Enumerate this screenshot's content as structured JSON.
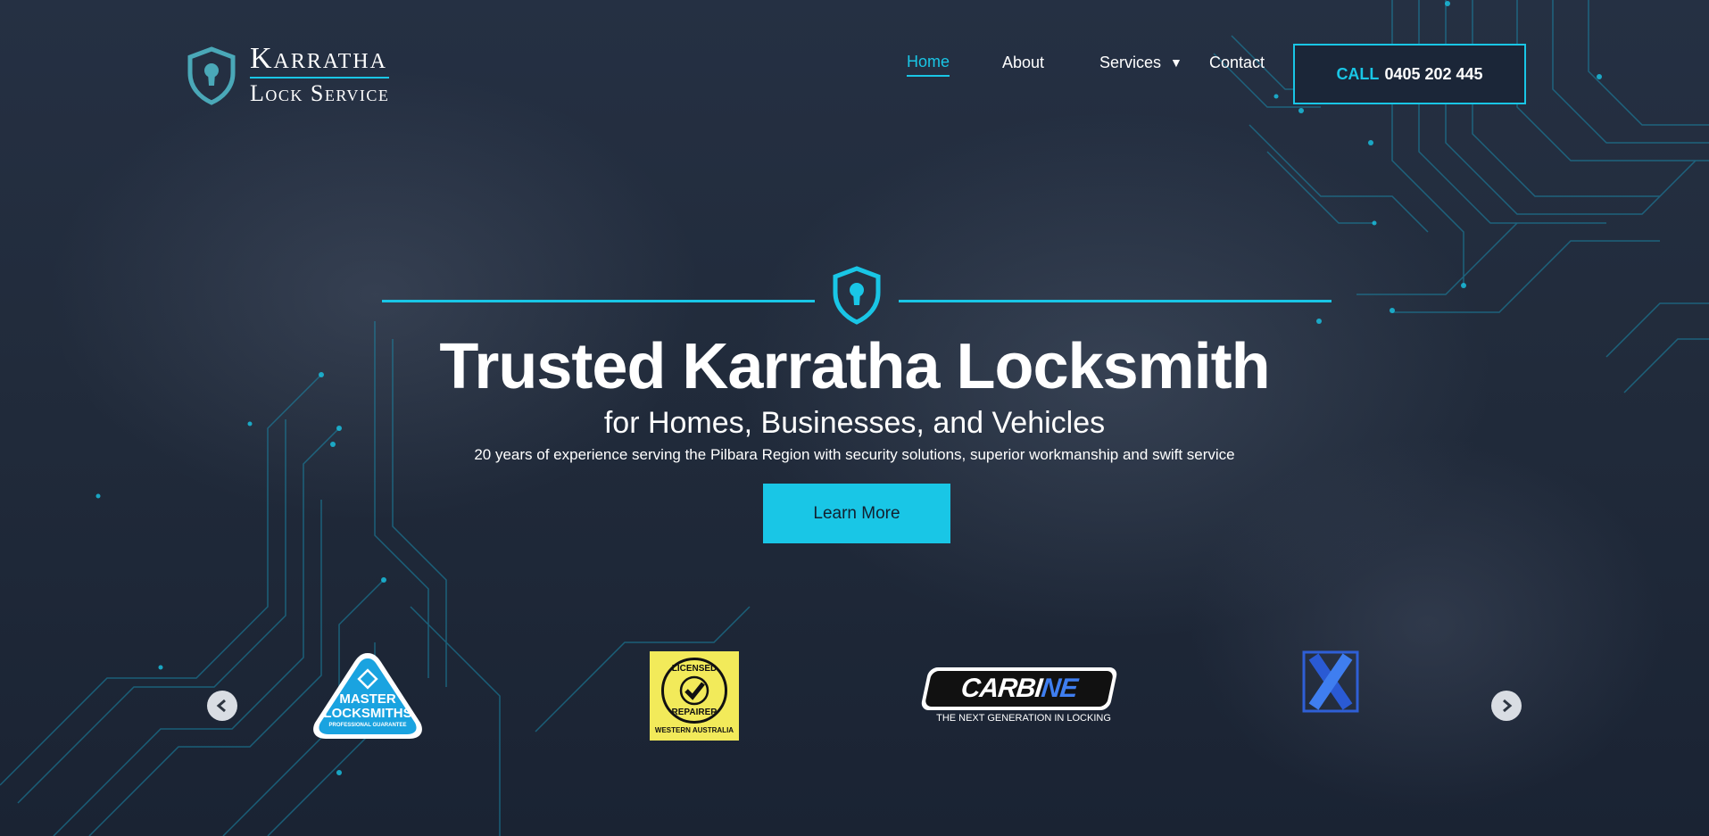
{
  "header": {
    "logo": {
      "line1": "Karratha",
      "line2": "Lock Service"
    },
    "nav": [
      {
        "label": "Home",
        "active": true
      },
      {
        "label": "About",
        "active": false
      },
      {
        "label": "Services",
        "active": false,
        "has_dropdown": true
      },
      {
        "label": "Contact",
        "active": false
      }
    ],
    "call_button": {
      "prefix": "CALL",
      "number": "0405 202 445"
    }
  },
  "hero": {
    "title": "Trusted Karratha Locksmith",
    "subtitle": "for Homes, Businesses, and Vehicles",
    "tagline": "20 years of experience serving the Pilbara Region with security solutions, superior workmanship and swift service",
    "cta_label": "Learn More"
  },
  "carousel": {
    "prev_icon": "chevron-left-icon",
    "next_icon": "chevron-right-icon",
    "brands": [
      {
        "name": "master-locksmiths",
        "line1": "MASTER",
        "line2": "LOCKSMITHS",
        "line3": "PROFESSIONAL GUARANTEE"
      },
      {
        "name": "licensed-repairer",
        "line1": "LICENSED",
        "line2": "REPAIRER",
        "line3": "WESTERN AUSTRALIA"
      },
      {
        "name": "carbine",
        "word_a": "CARBI",
        "word_b": "NE",
        "tagline": "THE NEXT GENERATION IN LOCKING"
      },
      {
        "name": "x-brand"
      }
    ]
  },
  "colors": {
    "accent": "#19c6e6",
    "background": "#1c2636",
    "button_text": "#12202f"
  }
}
